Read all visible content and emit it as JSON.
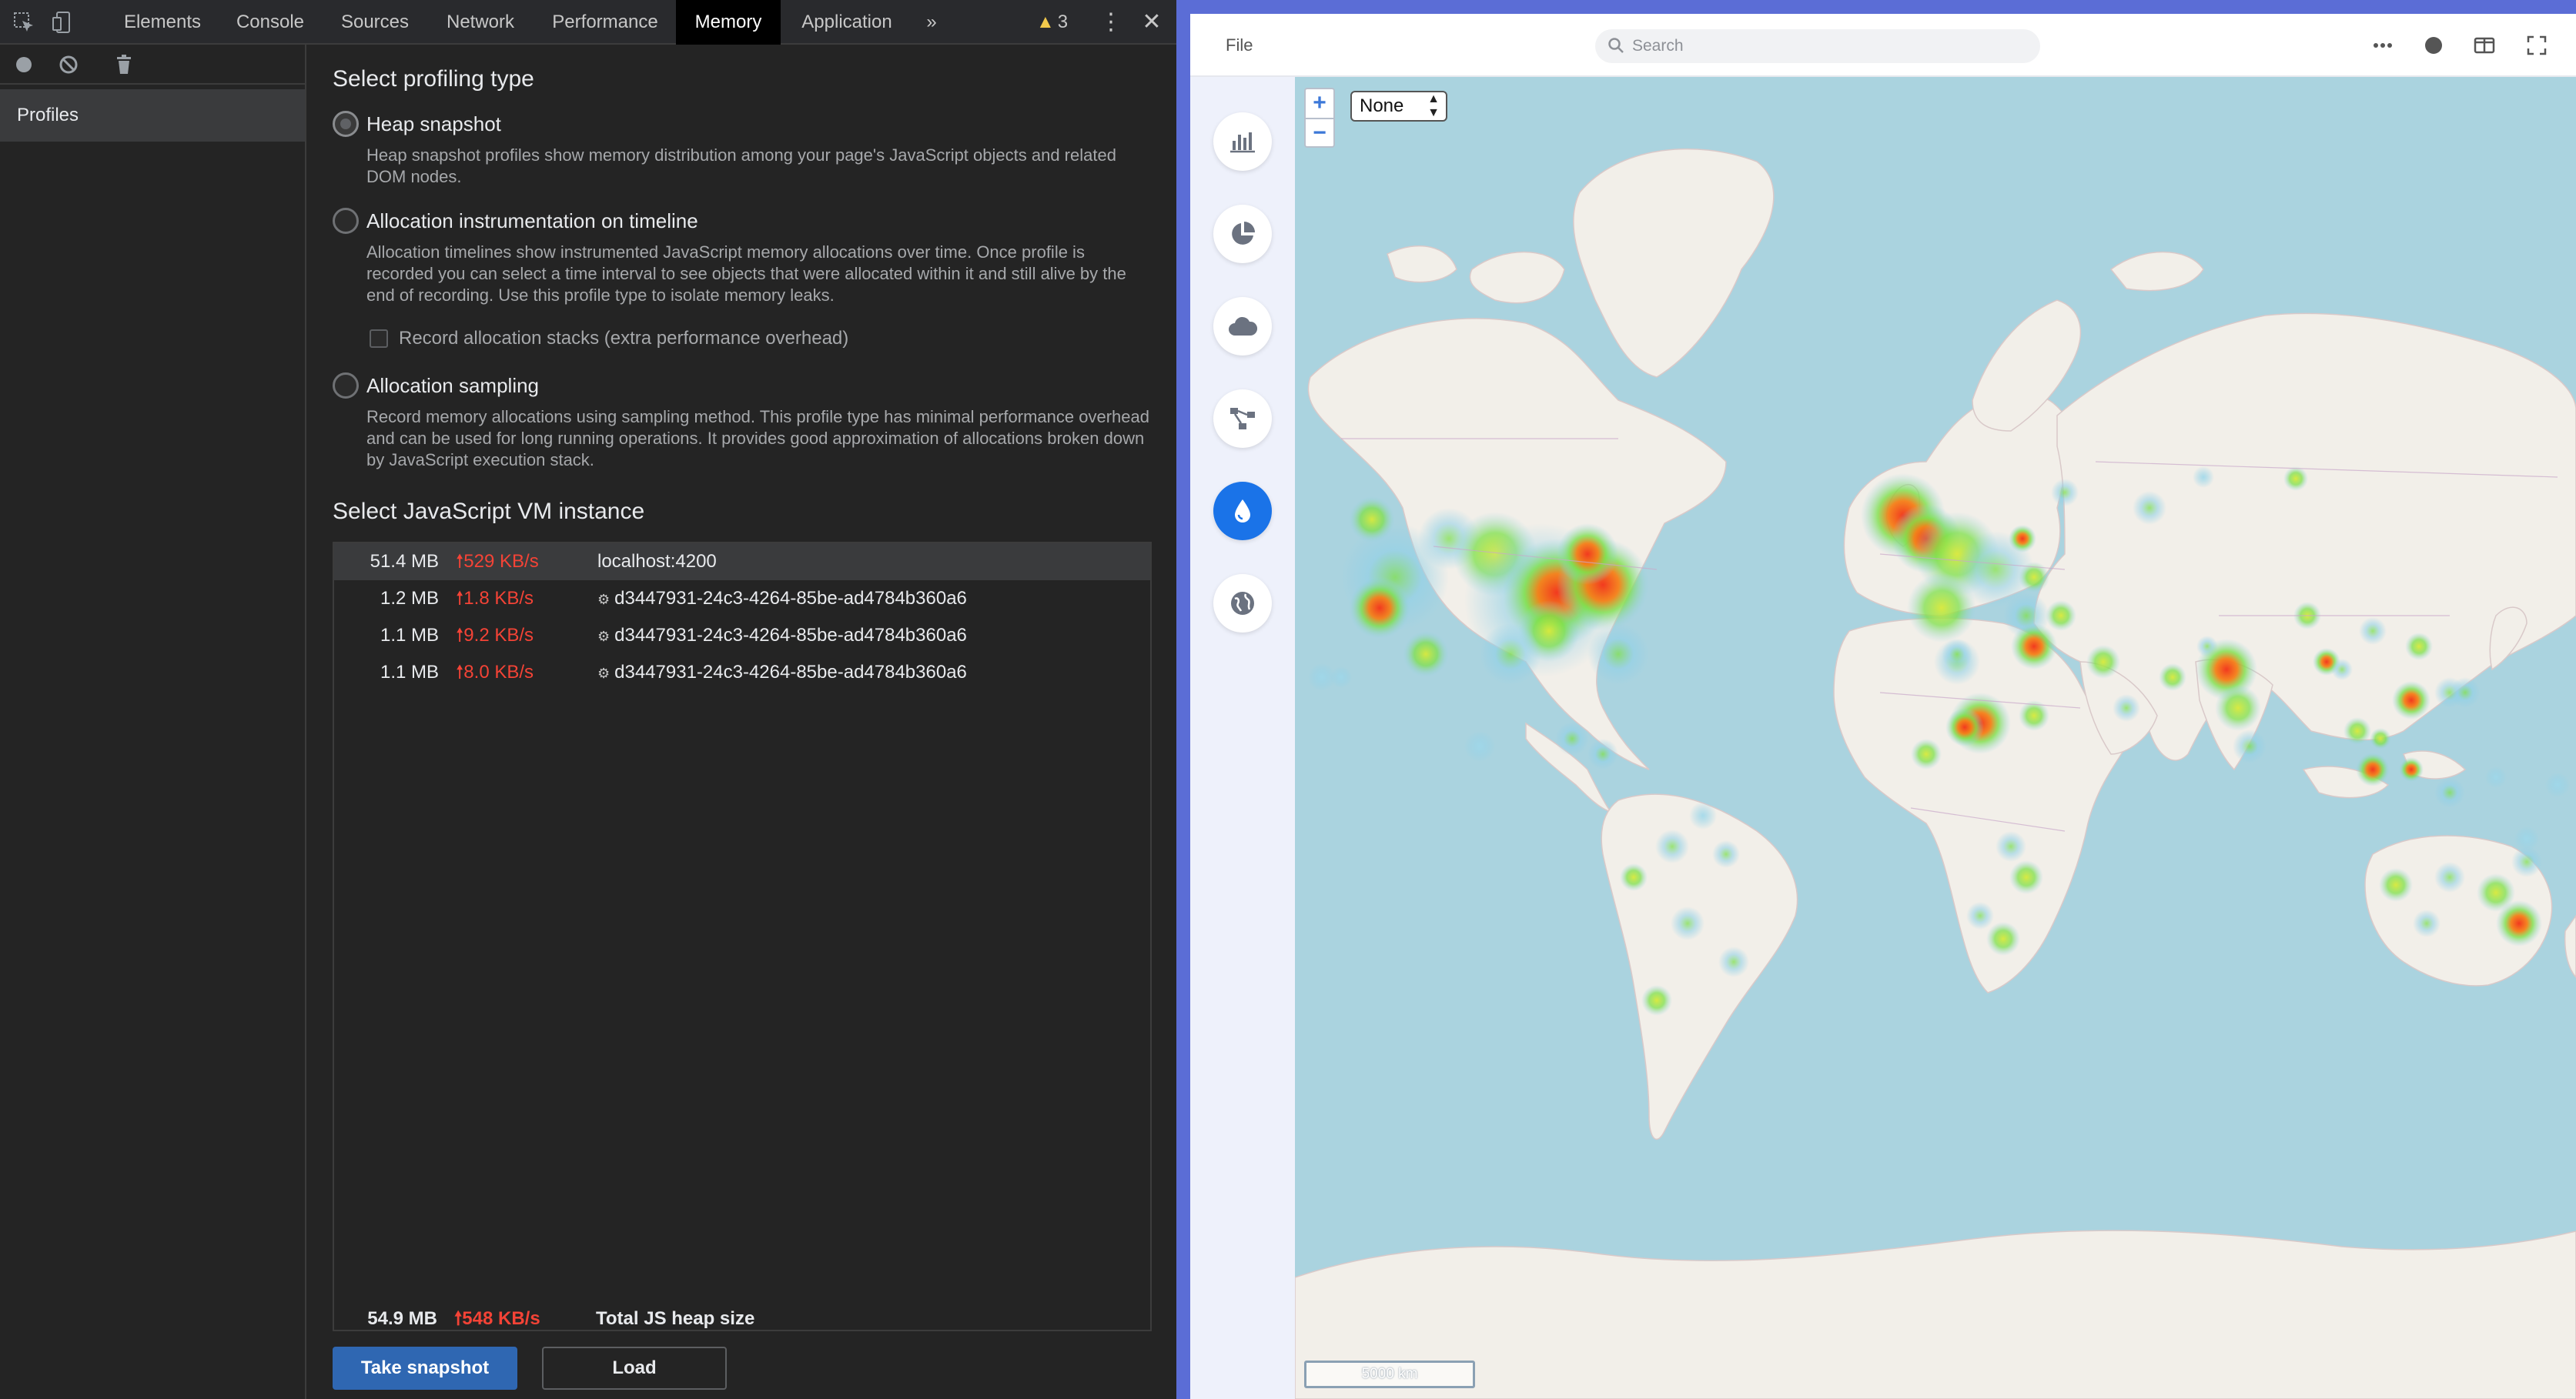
{
  "devtools": {
    "tabs": [
      "Elements",
      "Console",
      "Sources",
      "Network",
      "Performance",
      "Memory",
      "Application"
    ],
    "active_tab": "Memory",
    "more_tabs": "»",
    "warning_count": "3",
    "sidebar": {
      "profiles_label": "Profiles"
    },
    "profiling": {
      "heading": "Select profiling type",
      "options": [
        {
          "title": "Heap snapshot",
          "description": "Heap snapshot profiles show memory distribution among your page's JavaScript objects and related DOM nodes."
        },
        {
          "title": "Allocation instrumentation on timeline",
          "description": "Allocation timelines show instrumented JavaScript memory allocations over time. Once profile is recorded you can select a time interval to see objects that were allocated within it and still alive by the end of recording. Use this profile type to isolate memory leaks."
        },
        {
          "title": "Allocation sampling",
          "description": "Record memory allocations using sampling method. This profile type has minimal performance overhead and can be used for long running operations. It provides good approximation of allocations broken down by JavaScript execution stack."
        }
      ],
      "record_stacks_label": "Record allocation stacks (extra performance overhead)"
    },
    "vm": {
      "heading": "Select JavaScript VM instance",
      "rows": [
        {
          "size": "51.4 MB",
          "rate": "529 KB/s",
          "name": "localhost:4200"
        },
        {
          "size": "1.2 MB",
          "rate": "1.8 KB/s",
          "name": "d3447931-24c3-4264-85be-ad4784b360a6"
        },
        {
          "size": "1.1 MB",
          "rate": "9.2 KB/s",
          "name": "d3447931-24c3-4264-85be-ad4784b360a6"
        },
        {
          "size": "1.1 MB",
          "rate": "8.0 KB/s",
          "name": "d3447931-24c3-4264-85be-ad4784b360a6"
        }
      ],
      "total": {
        "size": "54.9 MB",
        "rate": "548 KB/s",
        "label": "Total JS heap size"
      }
    },
    "buttons": {
      "take_snapshot": "Take snapshot",
      "load": "Load"
    }
  },
  "app": {
    "file_menu": "File",
    "search_placeholder": "Search",
    "top_icons": [
      "more-icon",
      "circle-icon",
      "split-view-icon",
      "fullscreen-icon"
    ],
    "rail_icons": [
      "bar-chart-icon",
      "pie-chart-icon",
      "cloud-icon",
      "network-icon",
      "drop-icon",
      "globe-icon"
    ],
    "rail_active": "drop-icon",
    "map": {
      "zoom_in": "+",
      "zoom_out": "−",
      "layer_value": "None",
      "scale_label": "5000 km",
      "colors": {
        "ocean": "#aad3df",
        "land": "#f2efe9",
        "heat_low": "#8fd0e8",
        "heat_mid": "#7ee04a",
        "heat_high": "#f23a1f"
      }
    }
  },
  "colors": {
    "accent": "#1a73e8",
    "rate_red": "#f44336",
    "devtools_bg": "#242424",
    "app_frame": "#5b6dd6"
  }
}
